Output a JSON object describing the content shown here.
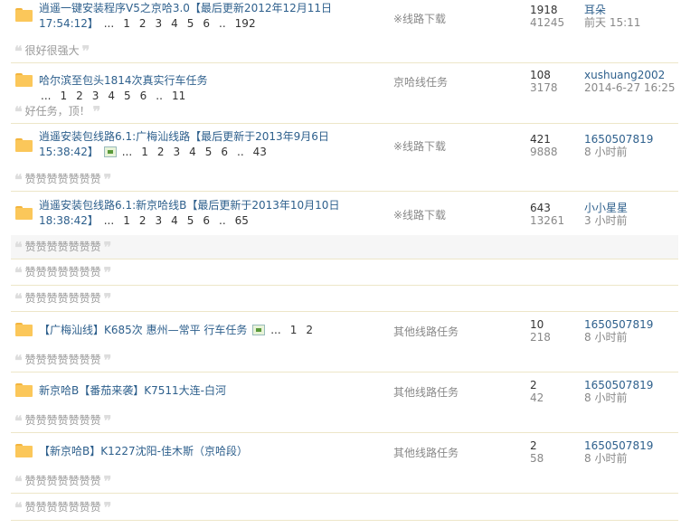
{
  "threads": [
    {
      "title_line1": "逍遥一键安装程序V5之京哈3.0【最后更新2012年12月11日",
      "title_line2": "17:54:12】",
      "pages": [
        "...",
        "1",
        "2",
        "3",
        "4",
        "5",
        "6",
        "..",
        "192"
      ],
      "forum": "※线路下载",
      "replies": "1918",
      "views": "41245",
      "user": "耳朵",
      "time": "前天 15:11",
      "reply_text": "很好很强大"
    },
    {
      "title_line1": "哈尔滨至包头1814次真实行车任务",
      "pages": [
        "...",
        "1",
        "2",
        "3",
        "4",
        "5",
        "6",
        "..",
        "11"
      ],
      "forum": "京哈线任务",
      "replies": "108",
      "views": "3178",
      "user": "xushuang2002",
      "time": "2014-6-27 16:25",
      "reply_text": "好任务，顶！"
    },
    {
      "title_line1": "逍遥安装包线路6.1:广梅汕线路【最后更新于2013年9月6日",
      "title_line2": "15:38:42】",
      "pages": [
        "...",
        "1",
        "2",
        "3",
        "4",
        "5",
        "6",
        "..",
        "43"
      ],
      "forum": "※线路下载",
      "replies": "421",
      "views": "9888",
      "user": "1650507819",
      "time": "8 小时前",
      "reply_text": "赞赞赞赞赞赞赞"
    },
    {
      "title_line1": "逍遥安装包线路6.1:新京哈线B【最后更新于2013年10月10日",
      "title_line2": "18:38:42】",
      "pages": [
        "...",
        "1",
        "2",
        "3",
        "4",
        "5",
        "6",
        "..",
        "65"
      ],
      "forum": "※线路下载",
      "replies": "643",
      "views": "13261",
      "user": "小小星星",
      "time": "3 小时前",
      "reply_text": "赞赞赞赞赞赞赞"
    },
    {
      "title_line1": "【广梅汕线】K685次 惠州—常平 行车任务",
      "pages": [
        "...",
        "1",
        "2"
      ],
      "forum": "其他线路任务",
      "replies": "10",
      "views": "218",
      "user": "1650507819",
      "time": "8 小时前",
      "reply_text": "赞赞赞赞赞赞赞"
    },
    {
      "title_line1": "新京哈B【番茄来袭】K7511大连-白河",
      "forum": "其他线路任务",
      "replies": "2",
      "views": "42",
      "user": "1650507819",
      "time": "8 小时前",
      "reply_text": "赞赞赞赞赞赞赞"
    },
    {
      "title_line1": "【新京哈B】K1227沈阳-佳木斯（京哈段）",
      "forum": "其他线路任务",
      "replies": "2",
      "views": "58",
      "user": "1650507819",
      "time": "8 小时前",
      "reply_text": "赞赞赞赞赞赞赞"
    }
  ],
  "extra_replies": [
    "赞赞赞赞赞赞赞",
    "赞赞赞赞赞赞赞",
    "赞赞赞赞赞赞赞"
  ]
}
